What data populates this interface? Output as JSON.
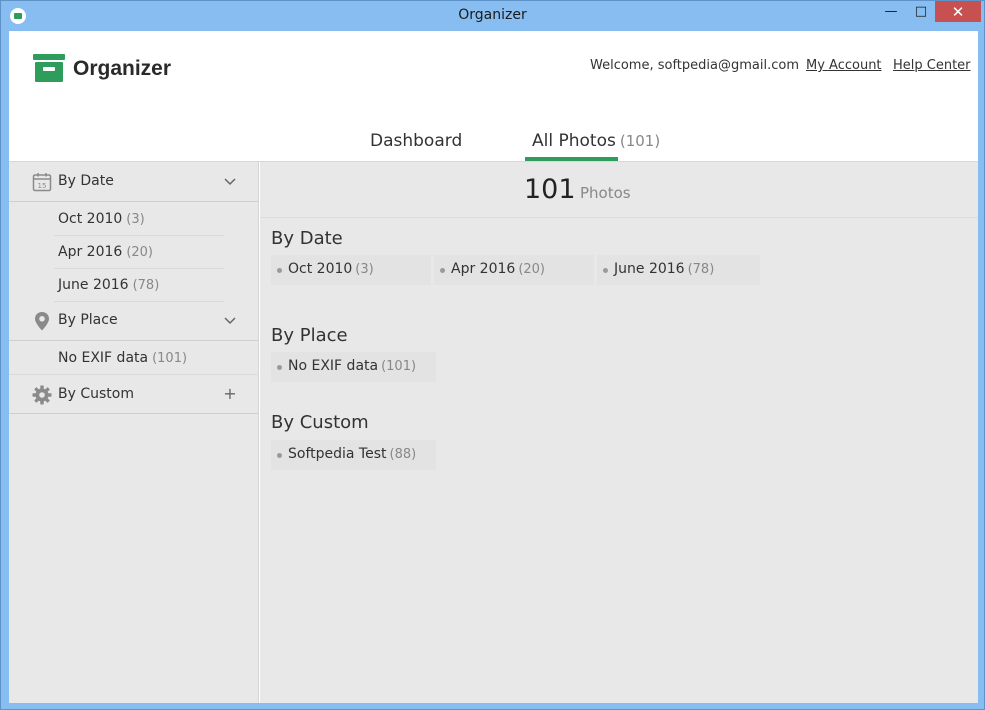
{
  "window": {
    "title": "Organizer",
    "minimize_glyph": "—",
    "maximize_glyph": "□",
    "close_glyph": "✕"
  },
  "header": {
    "logo_text": "Organizer",
    "welcome": "Welcome, softpedia@gmail.com",
    "my_account": "My Account",
    "help_center": "Help Center",
    "tabs": [
      {
        "label": "Dashboard",
        "count": ""
      },
      {
        "label": "All Photos",
        "count": "(101)"
      }
    ],
    "active_tab": "All Photos"
  },
  "sidebar": {
    "groups": [
      {
        "label": "By Date",
        "icon": "calendar-icon",
        "action": "chevron-down-icon",
        "items": [
          {
            "label": "Oct 2010",
            "count": "(3)"
          },
          {
            "label": "Apr 2016",
            "count": "(20)"
          },
          {
            "label": "June 2016",
            "count": "(78)"
          }
        ]
      },
      {
        "label": "By Place",
        "icon": "map-pin-icon",
        "action": "chevron-down-icon",
        "items": [
          {
            "label": "No EXIF data",
            "count": "(101)"
          }
        ]
      },
      {
        "label": "By Custom",
        "icon": "gear-icon",
        "action": "plus-icon",
        "action_glyph": "+",
        "items": []
      }
    ]
  },
  "main": {
    "total": "101",
    "total_word": "Photos",
    "sections": [
      {
        "title": "By Date",
        "chips": [
          {
            "label": "Oct 2010",
            "count": "(3)"
          },
          {
            "label": "Apr 2016",
            "count": "(20)"
          },
          {
            "label": "June 2016",
            "count": "(78)"
          }
        ]
      },
      {
        "title": "By Place",
        "chips": [
          {
            "label": "No EXIF data",
            "count": "(101)"
          }
        ]
      },
      {
        "title": "By Custom",
        "chips": [
          {
            "label": "Softpedia Test",
            "count": "(88)"
          }
        ]
      }
    ]
  },
  "colors": {
    "accent": "#2e9c5a",
    "titlebar": "#87bdf0",
    "close_button": "#c75050",
    "panel_bg": "#e8e8e8"
  }
}
